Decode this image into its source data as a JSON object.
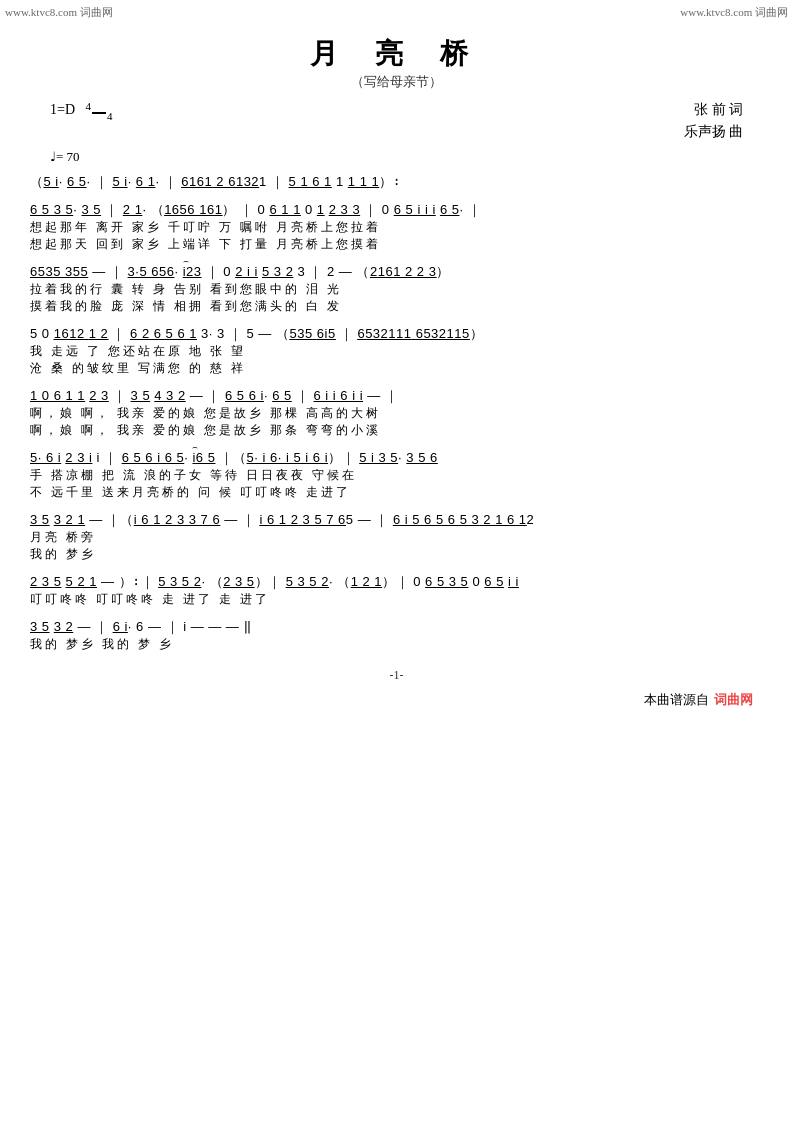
{
  "watermark": {
    "left": "www.ktvc8.com 词曲网",
    "right": "www.ktvc8.com 词曲网"
  },
  "title": {
    "main": "月  亮  桥",
    "subtitle": "（写给母亲节）"
  },
  "meta": {
    "key": "1=D",
    "time": "4/4",
    "tempo": "♩= 70",
    "lyricist_label": "张  前  词",
    "composer_label": "乐声扬  曲"
  },
  "page": {
    "number": "-1-"
  },
  "footer": {
    "label": "本曲谱源自",
    "brand": "词曲网"
  }
}
